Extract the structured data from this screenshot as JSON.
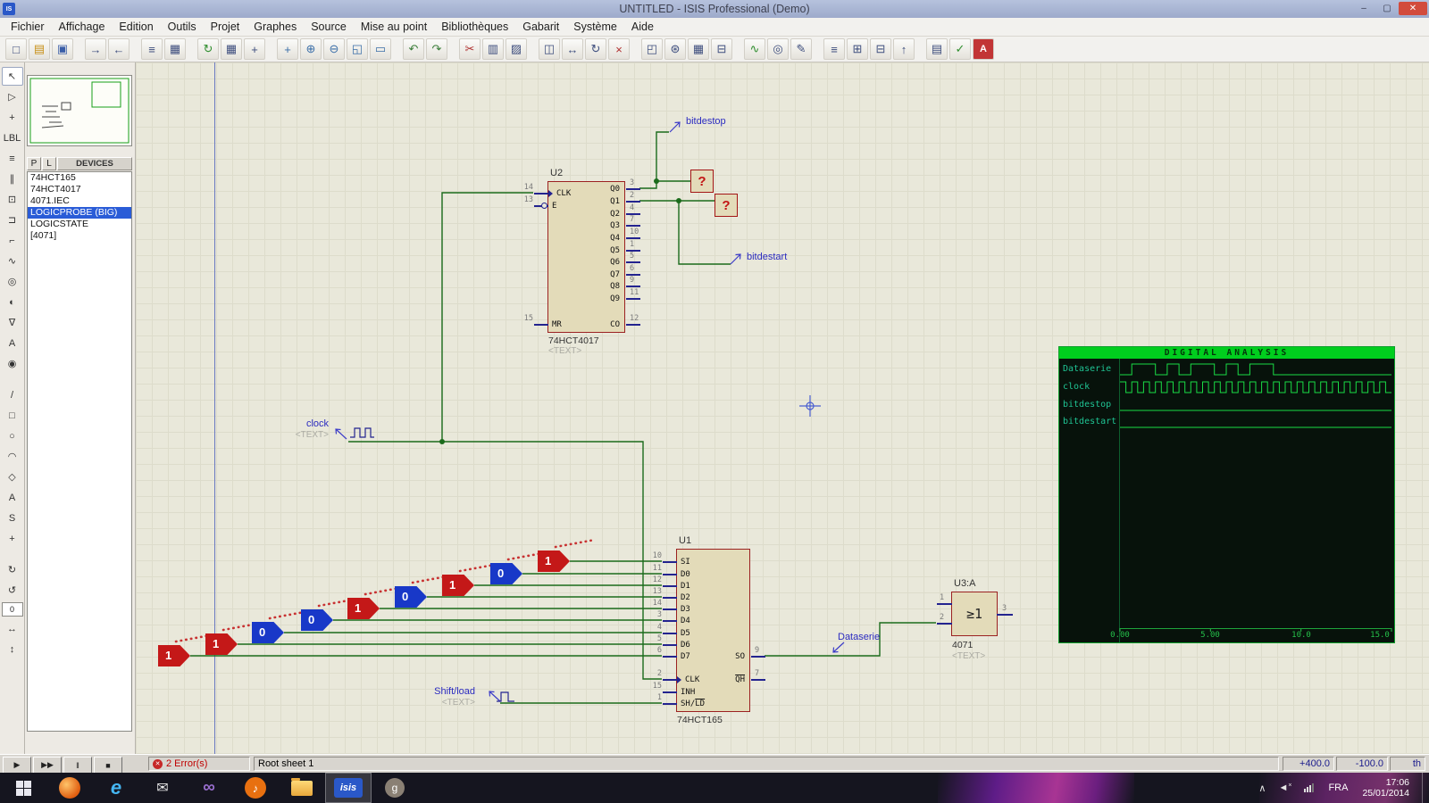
{
  "window": {
    "title": "UNTITLED - ISIS Professional (Demo)",
    "app_icon": "IS",
    "controls": {
      "minimize": "–",
      "maximize": "▢",
      "close": "✕"
    }
  },
  "menu": {
    "items": [
      "Fichier",
      "Affichage",
      "Edition",
      "Outils",
      "Projet",
      "Graphes",
      "Source",
      "Mise au point",
      "Bibliothèques",
      "Gabarit",
      "Système",
      "Aide"
    ]
  },
  "toolbar": {
    "groups": [
      [
        {
          "n": "new-design",
          "g": "□"
        },
        {
          "n": "open-design",
          "g": "▤",
          "c": "#C89018"
        },
        {
          "n": "save-design",
          "g": "▣",
          "c": "#3A5EA8"
        }
      ],
      [
        {
          "n": "import-section",
          "g": "→"
        },
        {
          "n": "export-section",
          "g": "←"
        }
      ],
      [
        {
          "n": "print",
          "g": "≡"
        },
        {
          "n": "mark-output-area",
          "g": "▦"
        }
      ],
      [
        {
          "n": "refresh-display",
          "g": "↻",
          "c": "#2E8E2E"
        },
        {
          "n": "toggle-grid",
          "g": "▦"
        },
        {
          "n": "false-origin",
          "g": "+"
        }
      ],
      [
        {
          "n": "center-at-cursor",
          "g": "+",
          "c": "#3A6EA8"
        },
        {
          "n": "zoom-in",
          "g": "⊕",
          "c": "#3A6EA8"
        },
        {
          "n": "zoom-out",
          "g": "⊖",
          "c": "#3A6EA8"
        },
        {
          "n": "zoom-all",
          "g": "◱",
          "c": "#3A6EA8"
        },
        {
          "n": "zoom-area",
          "g": "▭",
          "c": "#3A6EA8"
        }
      ],
      [
        {
          "n": "undo",
          "g": "↶",
          "c": "#3A7E3A"
        },
        {
          "n": "redo",
          "g": "↷",
          "c": "#3A7E3A"
        }
      ],
      [
        {
          "n": "cut",
          "g": "✂",
          "c": "#B03030"
        },
        {
          "n": "copy",
          "g": "▥"
        },
        {
          "n": "paste",
          "g": "▨"
        }
      ],
      [
        {
          "n": "block-copy",
          "g": "◫"
        },
        {
          "n": "block-move",
          "g": "↔"
        },
        {
          "n": "block-rotate",
          "g": "↻"
        },
        {
          "n": "block-delete",
          "g": "×",
          "c": "#B03030"
        }
      ],
      [
        {
          "n": "pick-parts",
          "g": "◰"
        },
        {
          "n": "make-device",
          "g": "⊛"
        },
        {
          "n": "packaging-tool",
          "g": "▦"
        },
        {
          "n": "decompose",
          "g": "⊟"
        }
      ],
      [
        {
          "n": "wire-autorouter",
          "g": "∿",
          "c": "#2E8E2E"
        },
        {
          "n": "search-and-tag",
          "g": "◎"
        },
        {
          "n": "property-assignment",
          "g": "✎"
        }
      ],
      [
        {
          "n": "design-explorer",
          "g": "≡"
        },
        {
          "n": "new-sheet",
          "g": "⊞"
        },
        {
          "n": "remove-sheet",
          "g": "⊟"
        },
        {
          "n": "exit-to-parent",
          "g": "↑"
        }
      ],
      [
        {
          "n": "bill-of-materials",
          "g": "▤"
        },
        {
          "n": "electrical-rules-check",
          "g": "✓",
          "c": "#2E8E2E"
        },
        {
          "n": "netlist-to-ares",
          "g": "A"
        }
      ]
    ]
  },
  "sidebar": {
    "p_button": "P",
    "l_button": "L",
    "devices_header": "DEVICES",
    "devices": [
      "74HCT165",
      "74HCT4017",
      "4071.IEC",
      "LOGICPROBE (BIG)",
      "LOGICSTATE",
      "[4071]"
    ],
    "selected_device": "LOGICPROBE (BIG)",
    "angle_display": "0",
    "tools": [
      {
        "n": "selection-pointer",
        "g": "↖",
        "active": true
      },
      {
        "n": "component-mode",
        "g": "▷"
      },
      {
        "n": "junction-dot-mode",
        "g": "+"
      },
      {
        "n": "wire-label-mode",
        "g": "LBL"
      },
      {
        "n": "text-script-mode",
        "g": "≡"
      },
      {
        "n": "buses-mode",
        "g": "∥"
      },
      {
        "n": "subcircuit-mode",
        "g": "⊡"
      },
      {
        "n": "terminals-mode",
        "g": "⊐"
      },
      {
        "n": "device-pins-mode",
        "g": "⌐"
      },
      {
        "n": "graph-mode",
        "g": "∿"
      },
      {
        "n": "tape-recorder-mode",
        "g": "◎"
      },
      {
        "n": "generator-mode",
        "g": "◐"
      },
      {
        "n": "voltage-probe-mode",
        "g": "∇"
      },
      {
        "n": "current-probe-mode",
        "g": "A"
      },
      {
        "n": "virtual-instruments-mode",
        "g": "◉"
      },
      {
        "spacer": true
      },
      {
        "n": "2d-line-mode",
        "g": "/"
      },
      {
        "n": "2d-box-mode",
        "g": "□"
      },
      {
        "n": "2d-circle-mode",
        "g": "○"
      },
      {
        "n": "2d-arc-mode",
        "g": "◠"
      },
      {
        "n": "2d-path-mode",
        "g": "◇"
      },
      {
        "n": "2d-text-mode",
        "g": "A"
      },
      {
        "n": "2d-symbol-mode",
        "g": "S"
      },
      {
        "n": "2d-marker-mode",
        "g": "+"
      },
      {
        "spacer": true
      },
      {
        "n": "rotate-clockwise",
        "g": "↻"
      },
      {
        "n": "rotate-anticlockwise",
        "g": "↺"
      },
      {
        "angle_box": true
      },
      {
        "n": "mirror-horizontal",
        "g": "↔"
      },
      {
        "n": "mirror-vertical",
        "g": "↕"
      }
    ]
  },
  "canvas": {
    "u2": {
      "ref": "U2",
      "value": "74HCT4017",
      "note": "<TEXT>",
      "left_pins": [
        {
          "num": "14",
          "name": "CLK",
          "clk": true
        },
        {
          "num": "13",
          "name": "E",
          "bubble": true
        },
        {
          "num": "15",
          "name": "MR"
        }
      ],
      "right_pins": [
        {
          "num": "3",
          "name": "Q0"
        },
        {
          "num": "2",
          "name": "Q1"
        },
        {
          "num": "4",
          "name": "Q2"
        },
        {
          "num": "7",
          "name": "Q3"
        },
        {
          "num": "10",
          "name": "Q4"
        },
        {
          "num": "1",
          "name": "Q5"
        },
        {
          "num": "5",
          "name": "Q6"
        },
        {
          "num": "6",
          "name": "Q7"
        },
        {
          "num": "9",
          "name": "Q8"
        },
        {
          "num": "11",
          "name": "Q9"
        },
        {
          "num": "12",
          "name": "CO"
        }
      ]
    },
    "u1": {
      "ref": "U1",
      "value": "74HCT165",
      "left_pins": [
        {
          "num": "10",
          "name": "SI"
        },
        {
          "num": "11",
          "name": "D0"
        },
        {
          "num": "12",
          "name": "D1"
        },
        {
          "num": "13",
          "name": "D2"
        },
        {
          "num": "14",
          "name": "D3"
        },
        {
          "num": "3",
          "name": "D4"
        },
        {
          "num": "4",
          "name": "D5"
        },
        {
          "num": "5",
          "name": "D6"
        },
        {
          "num": "6",
          "name": "D7"
        },
        {
          "num": "2",
          "name": "CLK",
          "clk": true
        },
        {
          "num": "15",
          "name": "INH"
        },
        {
          "num": "1",
          "name": "SH/",
          "name_ov": "LD"
        }
      ],
      "right_pins": [
        {
          "num": "9",
          "name": "SO"
        },
        {
          "num": "7",
          "name": "",
          "name_ov": "QH"
        }
      ]
    },
    "u3": {
      "ref": "U3:A",
      "value": "4071",
      "note": "<TEXT>",
      "symbol": "≥1",
      "pins_left": [
        "1",
        "2"
      ],
      "pins_right": [
        "3"
      ]
    },
    "labels": {
      "bitdestop": "bitdestop",
      "bitdestart": "bitdestart",
      "clock": "clock",
      "shiftload": "Shift/load",
      "dataserie": "Dataserie",
      "text_placeholder": "<TEXT>"
    },
    "unknown_marker": "?",
    "logic_states": [
      "1",
      "0",
      "1",
      "0",
      "1",
      "0",
      "0",
      "1",
      "1"
    ]
  },
  "analysis": {
    "title": "DIGITAL ANALYSIS",
    "signals": [
      {
        "name": "Dataserie",
        "bits": [
          0,
          1,
          1,
          0,
          1,
          0,
          1,
          1,
          0,
          1,
          0,
          1,
          1,
          0,
          0,
          0,
          0,
          0,
          0,
          0,
          0,
          0,
          0
        ]
      },
      {
        "name": "clock",
        "clock_halves": 46
      },
      {
        "name": "bitdestop",
        "bits": [
          0
        ]
      },
      {
        "name": "bitdestart",
        "bits": [
          0
        ]
      }
    ],
    "time_labels": [
      "0.00",
      "5.00",
      "10.0",
      "15.0"
    ]
  },
  "statusbar": {
    "sim_buttons": [
      {
        "n": "play",
        "g": "▶"
      },
      {
        "n": "step",
        "g": "▶▶"
      },
      {
        "n": "pause",
        "g": "‖"
      },
      {
        "n": "stop",
        "g": "■"
      }
    ],
    "errors": "2 Error(s)",
    "message": "Root sheet 1",
    "coord_x": "+400.0",
    "coord_y": "-100.0",
    "units": "th"
  },
  "taskbar": {
    "apps": [
      {
        "n": "start"
      },
      {
        "n": "firefox"
      },
      {
        "n": "internet-explorer",
        "g": "e"
      },
      {
        "n": "mail",
        "g": "✉"
      },
      {
        "n": "visual-studio",
        "g": "∞"
      },
      {
        "n": "media-player",
        "g": "♪"
      },
      {
        "n": "file-explorer"
      },
      {
        "n": "isis",
        "label": "isis",
        "active": true
      },
      {
        "n": "gimp",
        "g": "g"
      }
    ],
    "tray_chevron": "∧",
    "volume_glyph": "◄",
    "lang": "FRA",
    "time": "17:06",
    "date": "25/01/2014"
  },
  "colors": {
    "wire": "#1B6B1B",
    "state_high": "#C41818",
    "state_low": "#1838C8",
    "component_fill": "#E3DBB9",
    "component_border": "#9B2121",
    "trace_green": "#1ADC46",
    "selection_blue": "#2A5CD7"
  }
}
